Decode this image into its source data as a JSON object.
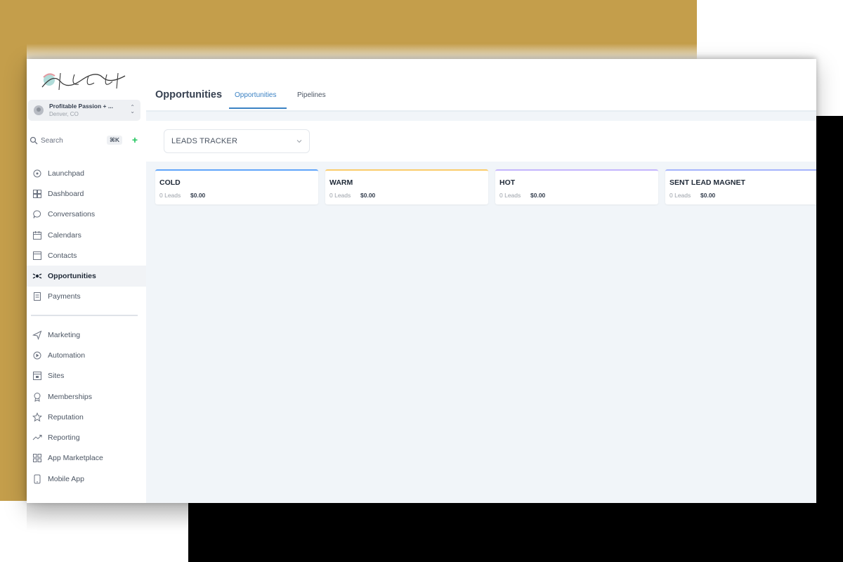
{
  "brand": {
    "logo_text": "The Coach Resort"
  },
  "account": {
    "name": "Profitable Passion + ...",
    "location": "Denver, CO"
  },
  "search": {
    "label": "Search",
    "shortcut": "⌘K",
    "add_symbol": "+"
  },
  "sidebar": {
    "items": [
      {
        "label": "Launchpad",
        "icon": "rocket-icon",
        "active": false
      },
      {
        "label": "Dashboard",
        "icon": "dashboard-icon",
        "active": false
      },
      {
        "label": "Conversations",
        "icon": "chat-icon",
        "active": false
      },
      {
        "label": "Calendars",
        "icon": "calendar-icon",
        "active": false
      },
      {
        "label": "Contacts",
        "icon": "contacts-icon",
        "active": false
      },
      {
        "label": "Opportunities",
        "icon": "opportunities-icon",
        "active": true
      },
      {
        "label": "Payments",
        "icon": "payments-icon",
        "active": false
      }
    ],
    "items2": [
      {
        "label": "Marketing",
        "icon": "send-icon"
      },
      {
        "label": "Automation",
        "icon": "automation-icon"
      },
      {
        "label": "Sites",
        "icon": "sites-icon"
      },
      {
        "label": "Memberships",
        "icon": "badge-icon"
      },
      {
        "label": "Reputation",
        "icon": "star-icon"
      },
      {
        "label": "Reporting",
        "icon": "trend-icon"
      },
      {
        "label": "App Marketplace",
        "icon": "grid-icon"
      },
      {
        "label": "Mobile App",
        "icon": "mobile-icon"
      }
    ]
  },
  "header": {
    "title": "Opportunities",
    "tabs": [
      {
        "label": "Opportunities",
        "active": true
      },
      {
        "label": "Pipelines",
        "active": false
      }
    ]
  },
  "pipeline_select": {
    "value": "LEADS TRACKER"
  },
  "columns": [
    {
      "title": "COLD",
      "count": "0 Leads",
      "amount": "$0.00",
      "color": "#60a5fa"
    },
    {
      "title": "WARM",
      "count": "0 Leads",
      "amount": "$0.00",
      "color": "#facc6b"
    },
    {
      "title": "HOT",
      "count": "0 Leads",
      "amount": "$0.00",
      "color": "#c4b5fd"
    },
    {
      "title": "SENT LEAD MAGNET",
      "count": "0 Leads",
      "amount": "$0.00",
      "color": "#a5b4fc"
    }
  ]
}
